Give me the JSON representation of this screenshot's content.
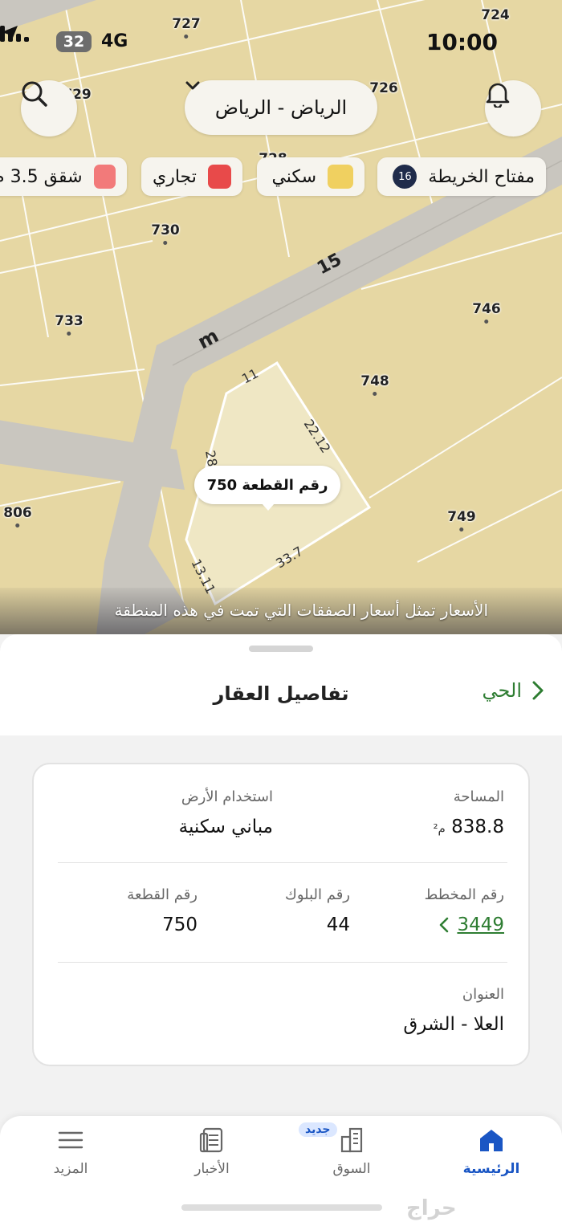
{
  "status_bar": {
    "time": "10:00",
    "battery": "32",
    "network": "4G"
  },
  "map": {
    "city_selector": "الرياض - الرياض",
    "legend": {
      "key_label": "مفتاح الخريطة",
      "key_count": "16",
      "residential": "سكني",
      "commercial": "تجاري",
      "apartments": "شقق 3.5 م"
    },
    "colors": {
      "residential": "#f0d060",
      "commercial": "#e84a4a",
      "apartments": "#f27a7a",
      "map_bg": "#e6d7a3",
      "road": "#c9c6bf",
      "highlight": "#efe7c4"
    },
    "parcel_numbers": [
      "727",
      "724",
      "729",
      "726",
      "728",
      "730",
      "746",
      "733",
      "748",
      "806",
      "749"
    ],
    "street_width": "15",
    "street_unit": "m",
    "plot_label": "رقم القطعة 750",
    "edge_dimensions": [
      "11",
      "22.12",
      "28",
      "33.7",
      "13.11"
    ],
    "disclaimer": "الأسعار تمثل أسعار الصفقات التي تمت في هذه المنطقة"
  },
  "sheet": {
    "title": "تفاصيل العقار",
    "back_label": "الحي",
    "area_label": "المساحة",
    "area_value": "838.8",
    "area_unit": "م²",
    "land_use_label": "استخدام الأرض",
    "land_use_value": "مباني سكنية",
    "scheme_label": "رقم المخطط",
    "scheme_value": "3449",
    "block_label": "رقم البلوك",
    "block_value": "44",
    "plot_label": "رقم القطعة",
    "plot_value": "750",
    "address_label": "العنوان",
    "address_value": "العلا - الشرق"
  },
  "tabbar": {
    "home": "الرئيسية",
    "market": "السوق",
    "market_badge": "جديد",
    "news": "الأخبار",
    "more": "المزيد"
  },
  "watermark": "حراج"
}
